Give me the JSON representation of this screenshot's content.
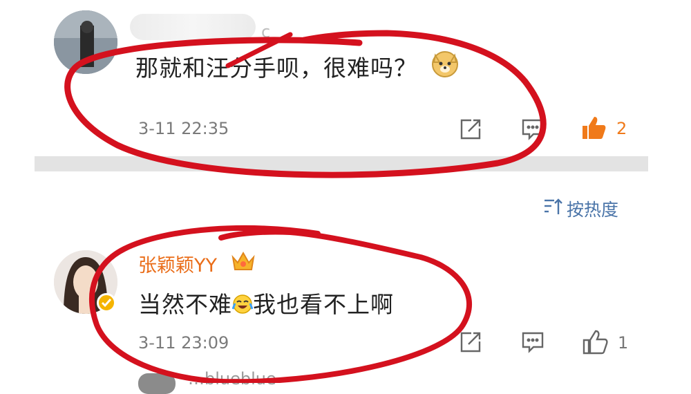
{
  "comment1": {
    "name_tail": "c",
    "text": "那就和汪分手呗，很难吗？",
    "time": "3-11 22:35",
    "likes": "2"
  },
  "sort": {
    "label": "按热度"
  },
  "comment2": {
    "name": "张颖颖YY",
    "text_before": "当然不难",
    "text_after": "我也看不上啊",
    "time": "3-11 23:09",
    "likes": "1"
  },
  "next_comment": {
    "name_fragment": "…blueblue"
  },
  "colors": {
    "accent_orange": "#ea6d19",
    "like_active": "#f07a1a",
    "link_blue": "#4a74a8",
    "annotation_red": "#d4111e"
  },
  "icons": [
    "share-icon",
    "comment-icon",
    "like-icon",
    "sort-icon",
    "crown-icon",
    "verified-icon",
    "doge-emoji-icon",
    "laugh-cry-emoji-icon"
  ]
}
